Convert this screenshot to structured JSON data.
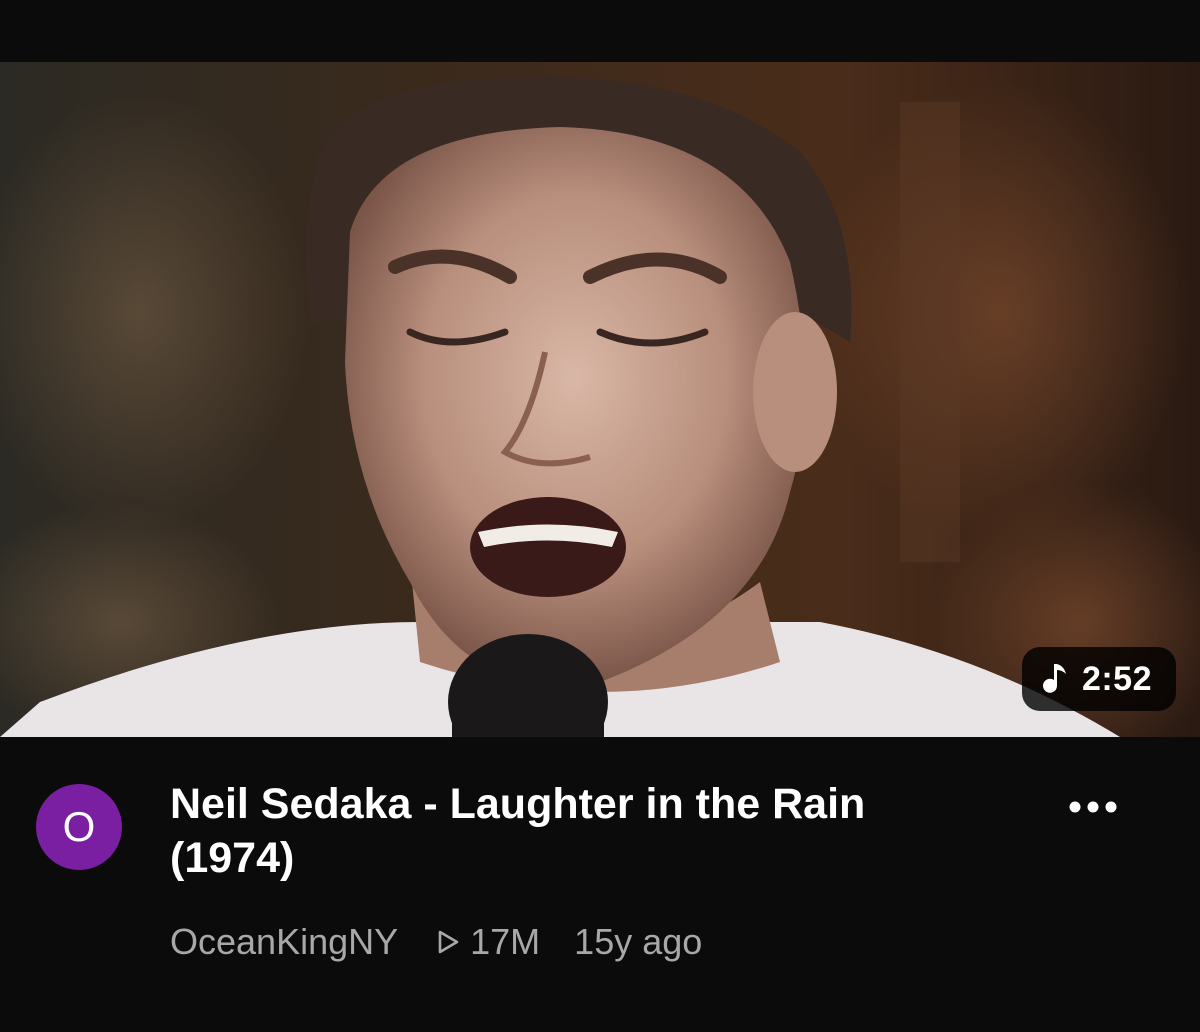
{
  "video": {
    "duration": "2:52",
    "duration_icon": "music-note-icon",
    "title": "Neil Sedaka - Laughter in the Rain (1974)",
    "channel": "OceanKingNY",
    "channel_initial": "O",
    "views": "17M",
    "views_icon": "play-outline-icon",
    "age": "15y ago",
    "more_icon": "more-horizontal-icon"
  },
  "colors": {
    "background": "#0b0b0b",
    "avatar": "#7b1fa2",
    "secondary_text": "#a8a8a8",
    "badge_background": "#000000cc"
  }
}
